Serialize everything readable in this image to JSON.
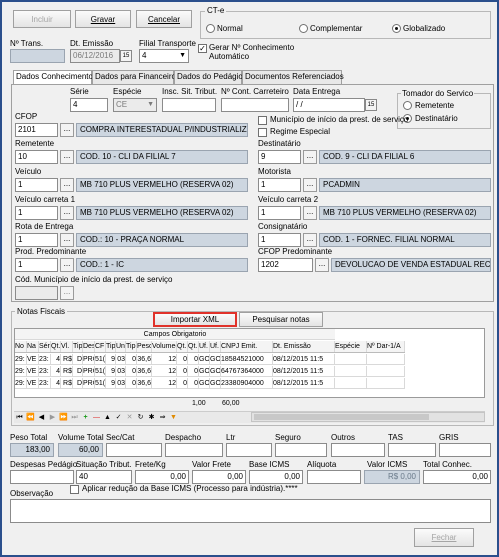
{
  "toolbar": {
    "incluir": "Incluir",
    "gravar": "Gravar",
    "cancelar": "Cancelar",
    "ct_e": "CT-e",
    "normal": "Normal",
    "complementar": "Complementar",
    "globalizado": "Globalizado"
  },
  "header": {
    "n_trans_label": "Nº Trans.",
    "n_trans": "",
    "dt_emissao_label": "Dt. Emissão",
    "dt_emissao": "06/12/2016",
    "filial_label": "Filial Transporte",
    "filial": "4",
    "gerar_label": "Gerar Nº Conhecimento",
    "automatico": "Automático"
  },
  "tabs": [
    "Dados Conhecimento",
    "Dados para Financeiro",
    "Dados do Pedágio",
    "Documentos Referenciados"
  ],
  "form": {
    "serie_label": "Série",
    "serie": "4",
    "especie_label": "Espécie",
    "especie": "CE",
    "insc_label": "Insc. Sit. Tribut.",
    "n_cont_label": "Nº Cont. Carreteiro",
    "data_entrega_label": "Data Entrega",
    "data_entrega": " / /",
    "tomador_label": "Tomador do Servico",
    "remetente_opt": "Remetente",
    "destinatario_opt": "Destinatário",
    "cfop_label": "CFOP",
    "cfop": "2101",
    "cfop_desc": "COMPRA INTERESTADUAL P/INDUSTRIALIZACAO",
    "municipio_chk": "Município de início da prest. de serviço",
    "regime_chk": "Regime Especial",
    "remetente_label": "Remetente",
    "remetente_cod": "10",
    "remetente_desc": "COD. 10 - CLI DA FILIAL 7",
    "destinatario_label": "Destinatário",
    "destinatario_cod": "9",
    "destinatario_desc": "COD. 9 - CLI DA FILIAL 6",
    "veiculo_label": "Veículo",
    "veiculo_cod": "1",
    "veiculo_desc": "MB 710 PLUS VERMELHO (RESERVA 02)",
    "motorista_label": "Motorista",
    "motorista_cod": "1",
    "motorista_desc": "PCADMIN",
    "carreta1_label": "Veículo carreta 1",
    "carreta1_cod": "1",
    "carreta1_desc": "MB 710 PLUS VERMELHO (RESERVA 02)",
    "carreta2_label": "Veículo carreta 2",
    "carreta2_cod": "1",
    "carreta2_desc": "MB 710 PLUS VERMELHO (RESERVA 02)",
    "rota_label": "Rota de Entrega",
    "rota_cod": "1",
    "rota_desc": "COD.: 10 - PRAÇA NORMAL",
    "consignatario_label": "Consignatário",
    "consignatario_cod": "1",
    "consignatario_desc": "COD. 1 - FORNEC. FILIAL NORMAL",
    "prod_label": "Prod. Predominante",
    "prod_cod": "1",
    "prod_desc": "COD.: 1 - IC",
    "cfop_pred_label": "CFOP Predominante",
    "cfop_pred": "1202",
    "cfop_pred_desc": "DEVOLUCAO DE VENDA ESTADUAL REC.DE TERCEI",
    "cod_mun_label": "Cód. Município de início da prest. de serviço"
  },
  "notas": {
    "title": "Notas Fiscais",
    "importar": "Importar XML",
    "pesquisar": "Pesquisar notas",
    "campos": "Campos Obrigatorio",
    "columns": [
      "No",
      "Na",
      "Sér",
      "Qt.",
      "Vl.",
      "Tip",
      "Des",
      "CF",
      "Tip",
      "Uni",
      "Tip",
      "Peso",
      "Volume(",
      "Qt.",
      "Qt.",
      "Uf.",
      "Uf.",
      "CNPJ Emit.",
      "Dt. Emissão",
      "Espécie",
      "Nº Dar-1/A"
    ],
    "rows": [
      [
        "29:",
        "VE",
        "23:",
        "4",
        "R$",
        "D",
        "PRC",
        "51(",
        "9",
        "03",
        "0",
        "36,6",
        "12",
        "0",
        "0",
        "GO",
        "GO",
        "18584521000",
        "08/12/2015 11:5",
        "",
        ""
      ],
      [
        "29:",
        "VE",
        "23:",
        "4",
        "R$",
        "D",
        "PRC",
        "51(",
        "9",
        "03",
        "0",
        "36,6",
        "12",
        "0",
        "0",
        "GO",
        "GO",
        "64767364000",
        "08/12/2015 11:5",
        "",
        ""
      ],
      [
        "29:",
        "VE",
        "23:",
        "4",
        "R$",
        "D",
        "PRC",
        "51(",
        "9",
        "03",
        "0",
        "36,6",
        "12",
        "0",
        "0",
        "GO",
        "GO",
        "23380904000",
        "08/12/2015 11:5",
        "",
        ""
      ]
    ],
    "total_peso": "1,00",
    "total_volume": "60,00"
  },
  "totals": {
    "peso_total_label": "Peso Total",
    "peso_total": "183,00",
    "volume_total_label": "Volume Total",
    "volume_total": "60,00",
    "sec_cat_label": "Sec/Cat",
    "despacho_label": "Despacho",
    "ltr_label": "Ltr",
    "seguro_label": "Seguro",
    "outros_label": "Outros",
    "tas_label": "TAS",
    "gris_label": "GRIS",
    "desp_pedagio_label": "Despesas Pedágio",
    "sit_trib_label": "Situação Tribut.",
    "sit_trib": "40",
    "frete_kg_label": "Frete/Kg",
    "frete_kg": "0,00",
    "valor_frete_label": "Valor Frete",
    "valor_frete": "0,00",
    "base_icms_label": "Base ICMS",
    "base_icms": "0,00",
    "aliquota_label": "Alíquota",
    "valor_icms_label": "Valor ICMS",
    "valor_icms": "R$ 0,00",
    "total_conhec_label": "Total Conhec.",
    "total_conhec": "0,00"
  },
  "observacao_label": "Observação",
  "aplicar_label": "Aplicar redução da Base ICMS (Processo para indústria).****",
  "fechar": "Fechar"
}
